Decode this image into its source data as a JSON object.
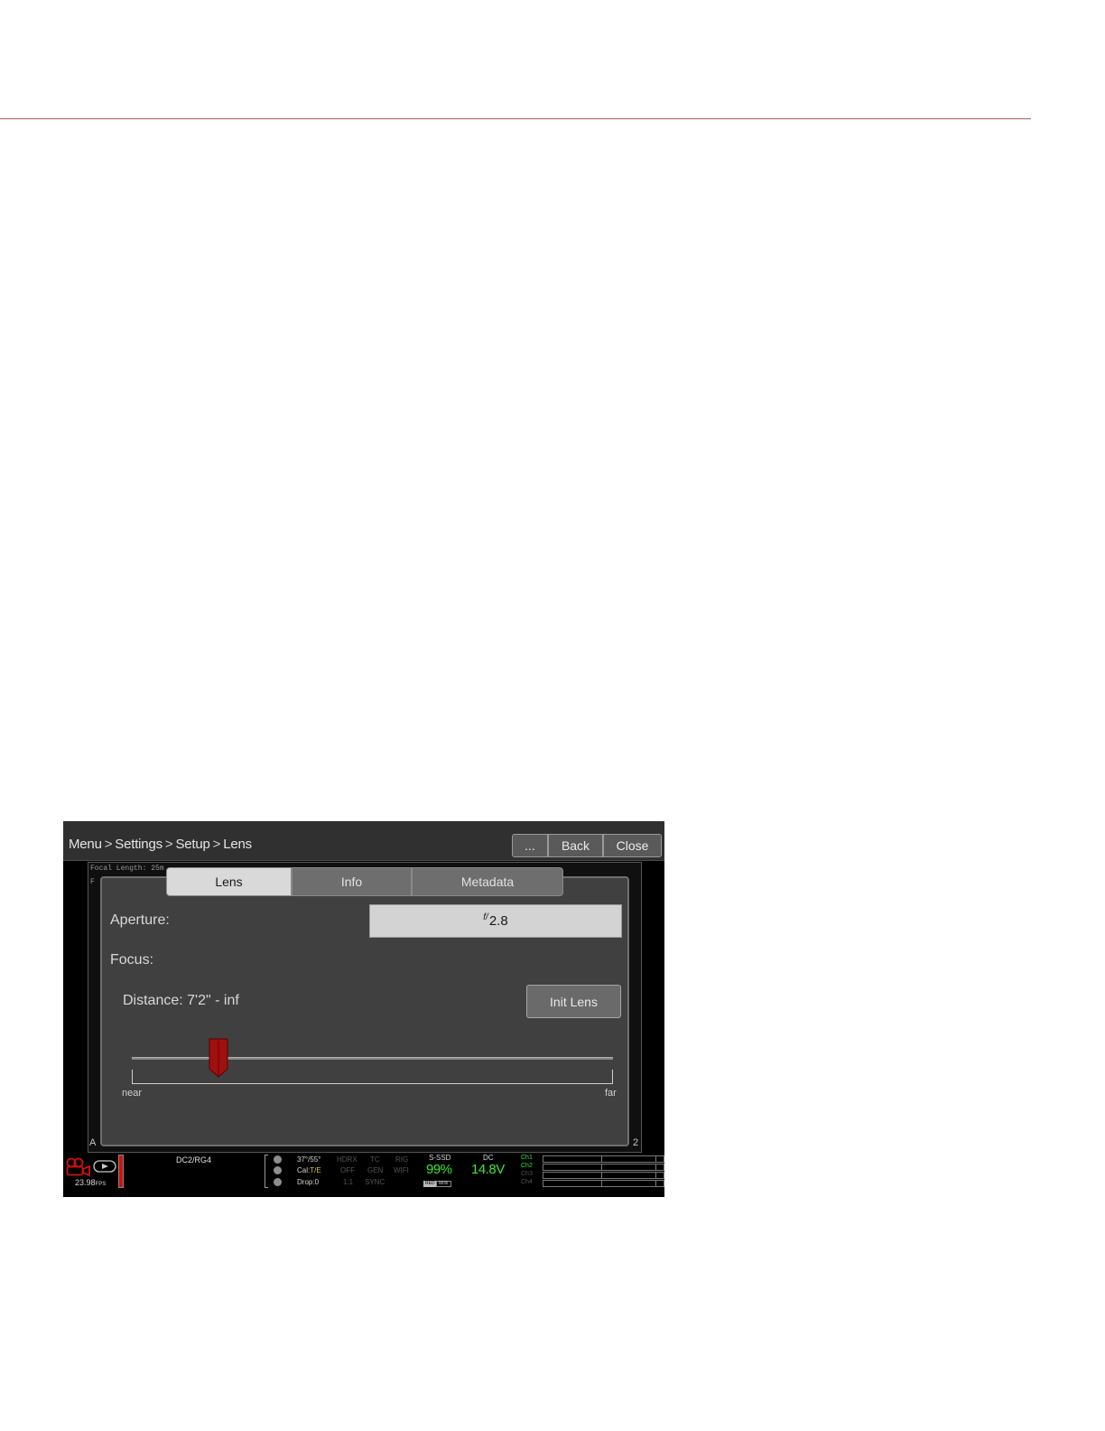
{
  "toolbar": {
    "breadcrumb": [
      "Menu",
      "Settings",
      "Setup",
      "Lens"
    ],
    "separator": ">",
    "more_label": "...",
    "back_label": "Back",
    "close_label": "Close"
  },
  "background": {
    "focal_length_text": "Focal Length: 25m",
    "partial_label_1": "F",
    "corner_left": "A",
    "corner_right": "2"
  },
  "dialog": {
    "tabs": [
      {
        "label": "Lens",
        "active": true
      },
      {
        "label": "Info",
        "active": false
      },
      {
        "label": "Metadata",
        "active": false
      }
    ],
    "aperture_label": "Aperture:",
    "aperture_prefix": "f/",
    "aperture_value": "2.8",
    "focus_label": "Focus:",
    "distance_label": "Distance: 7'2\" - inf",
    "init_lens_label": "Init Lens",
    "focus_slider": {
      "position_fraction": 0.18,
      "near_label": "near",
      "far_label": "far",
      "handle_color": "#a01010"
    }
  },
  "status": {
    "fps_value": "23.98",
    "fps_unit": "FPS",
    "codec": "DC2/RG4",
    "temp": "37°/55°",
    "cal_prefix": "Cal:",
    "cal_value": "T/E",
    "drop": "Drop:0",
    "hdrx": "HDRX",
    "hdrx_value": "OFF",
    "ratio": "1:1",
    "tc": "TC",
    "gen": "GEN",
    "sync": "SYNC",
    "rig": "RIG",
    "wifi": "WIFI",
    "media_label": "S-SSD",
    "media_value": "99%",
    "power_label": "DC",
    "power_value": "14.8V",
    "channels": [
      "Ch1",
      "Ch2",
      "Ch3",
      "Ch4"
    ],
    "accent_green": "#3ce63c",
    "rec_red": "#d01010"
  }
}
